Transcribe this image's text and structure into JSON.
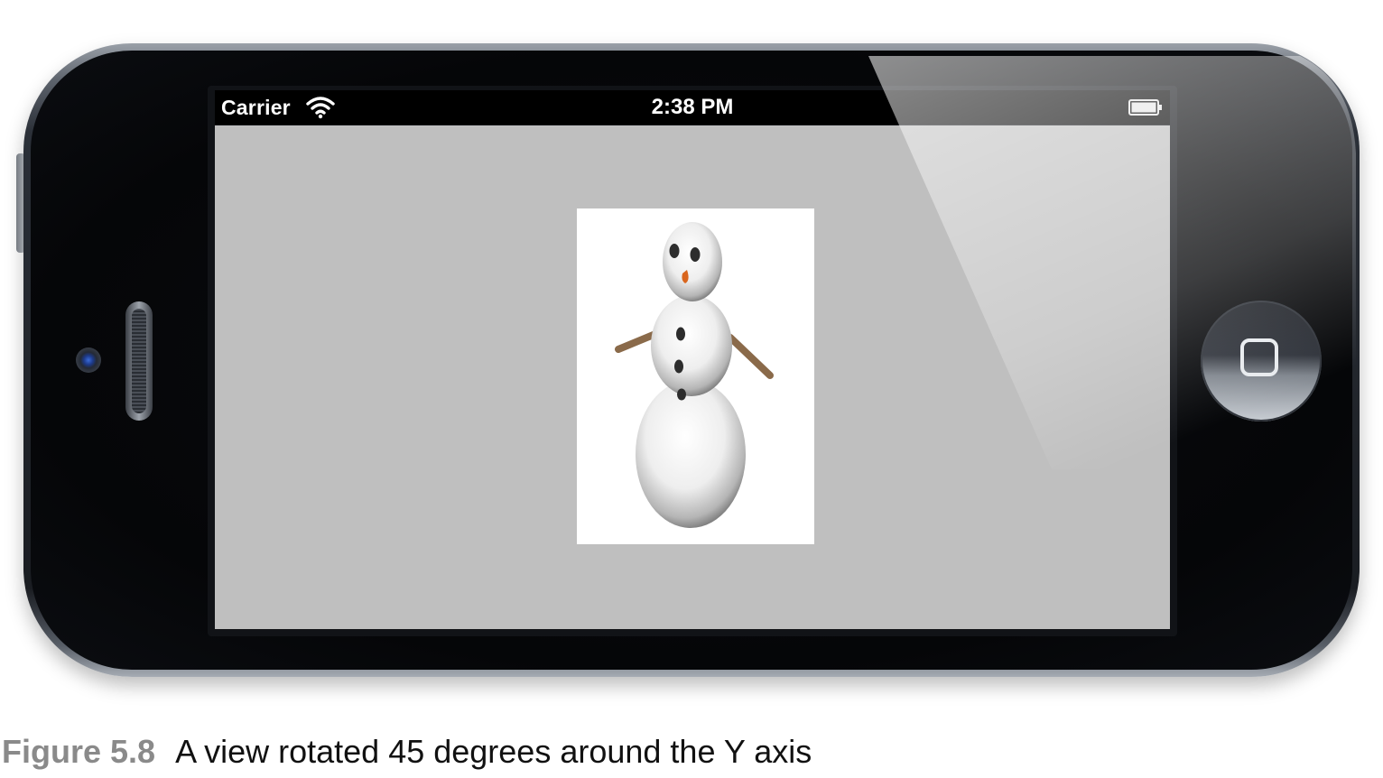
{
  "status_bar": {
    "carrier": "Carrier",
    "time": "2:38 PM"
  },
  "icons": {
    "wifi": "wifi-icon",
    "battery": "battery-icon",
    "home": "home-square-icon",
    "camera": "front-camera-icon"
  },
  "colors": {
    "screen_background": "#bfbfbf",
    "status_bar": "#000000",
    "caption_label": "#8a8a8a",
    "snowman_nose": "#d9661e",
    "snowman_arms": "#8a6a4a"
  },
  "caption": {
    "label": "Figure 5.8",
    "text": "A view rotated 45 degrees around the Y axis"
  }
}
